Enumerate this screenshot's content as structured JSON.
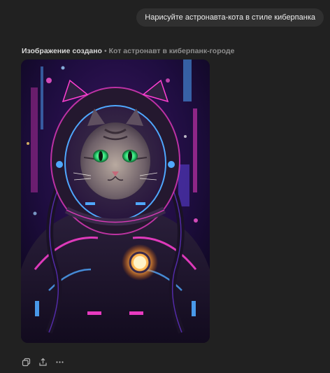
{
  "user_message": {
    "text": "Нарисуйте астронавта-кота в стиле киберпанка"
  },
  "assistant": {
    "caption_status": "Изображение создано",
    "caption_separator": "•",
    "caption_description": "Кот астронавт в киберпанк-городе"
  },
  "actions": [
    {
      "name": "copy-icon"
    },
    {
      "name": "share-icon"
    },
    {
      "name": "more-icon"
    }
  ],
  "colors": {
    "background": "#212121",
    "bubble": "#303030",
    "neon_pink": "#ff3fd2",
    "neon_blue": "#4fa8ff",
    "eye_green": "#2fe07a"
  }
}
